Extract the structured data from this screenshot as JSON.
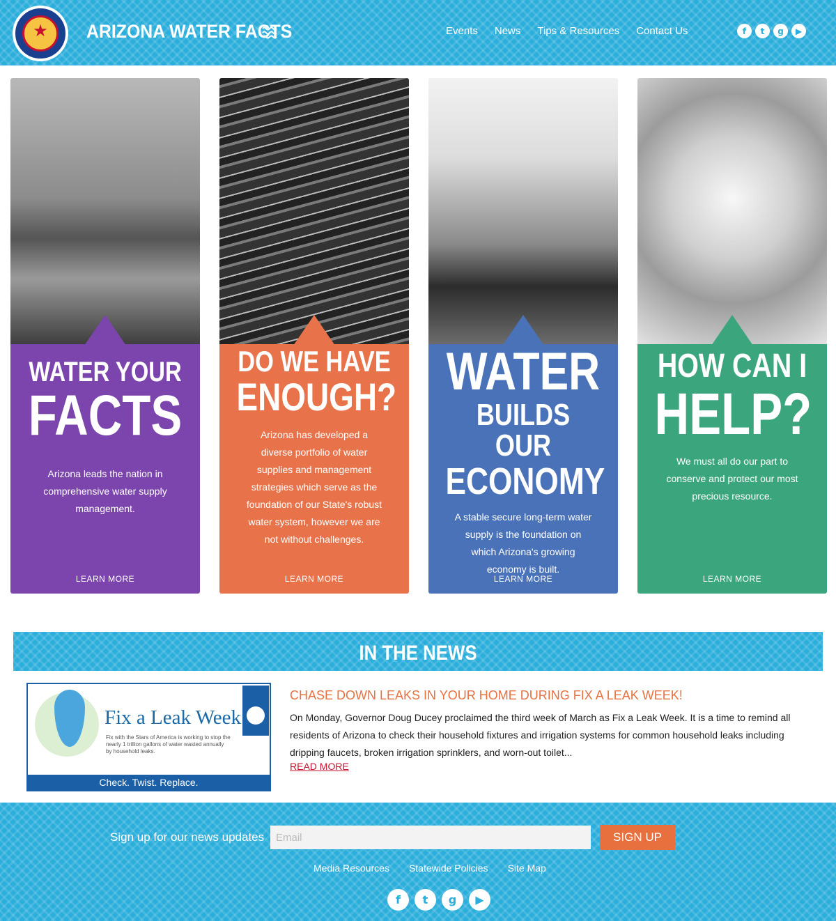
{
  "header": {
    "site_title": "ARIZONA WATER FACTS",
    "nav": [
      "Events",
      "News",
      "Tips & Resources",
      "Contact Us"
    ],
    "social_icons": [
      "facebook-icon",
      "twitter-icon",
      "google-plus-icon",
      "youtube-icon"
    ]
  },
  "cards": [
    {
      "heading_lines": [
        "WATER YOUR",
        "FACTS"
      ],
      "body": "Arizona leads the nation in comprehensive water supply management.",
      "cta": "LEARN MORE",
      "color": "#7b45ad"
    },
    {
      "heading_lines": [
        "DO WE HAVE",
        "ENOUGH?"
      ],
      "body": "Arizona has developed a diverse portfolio of water supplies and management strategies which serve as the foundation of our State's robust water system, however we are not without challenges.",
      "cta": "LEARN MORE",
      "color": "#e8734a"
    },
    {
      "heading_lines": [
        "WATER",
        "BUILDS OUR",
        "ECONOMY"
      ],
      "body": "A stable secure long-term water supply is the foundation on which Arizona's growing economy is built.",
      "cta": "LEARN MORE",
      "color": "#4a72b9"
    },
    {
      "heading_lines": [
        "HOW CAN I",
        "HELP?"
      ],
      "body": "We must all do our part to conserve and protect our most precious resource.",
      "cta": "LEARN MORE",
      "color": "#3ba57d"
    }
  ],
  "news": {
    "section_title": "IN THE NEWS",
    "image_title": "Fix a Leak Week",
    "image_small_text": "Fix with the Stars of America is working to stop the nearly 1 trillion gallons of water wasted annually by household leaks.",
    "image_tagline": "Check. Twist. Replace.",
    "headline": "CHASE DOWN LEAKS IN YOUR HOME DURING FIX A LEAK WEEK!",
    "body": "On Monday, Governor Doug Ducey proclaimed the third week of March as Fix a Leak Week. It is a time to remind all residents of Arizona to check their household fixtures and irrigation systems for common household leaks including dripping faucets, broken irrigation sprinklers, and worn-out toilet...",
    "read_more": "READ MORE"
  },
  "footer": {
    "signup_label": "Sign up for our news updates",
    "email_placeholder": "Email",
    "signup_button": "SIGN UP",
    "links": [
      "Media Resources",
      "Statewide Policies",
      "Site Map"
    ],
    "social_icons": [
      "facebook-icon",
      "twitter-icon",
      "google-plus-icon",
      "youtube-icon"
    ]
  },
  "colors": {
    "header_blue": "#2aaedb",
    "accent_orange": "#e8703f",
    "link_red": "#c8102e"
  }
}
